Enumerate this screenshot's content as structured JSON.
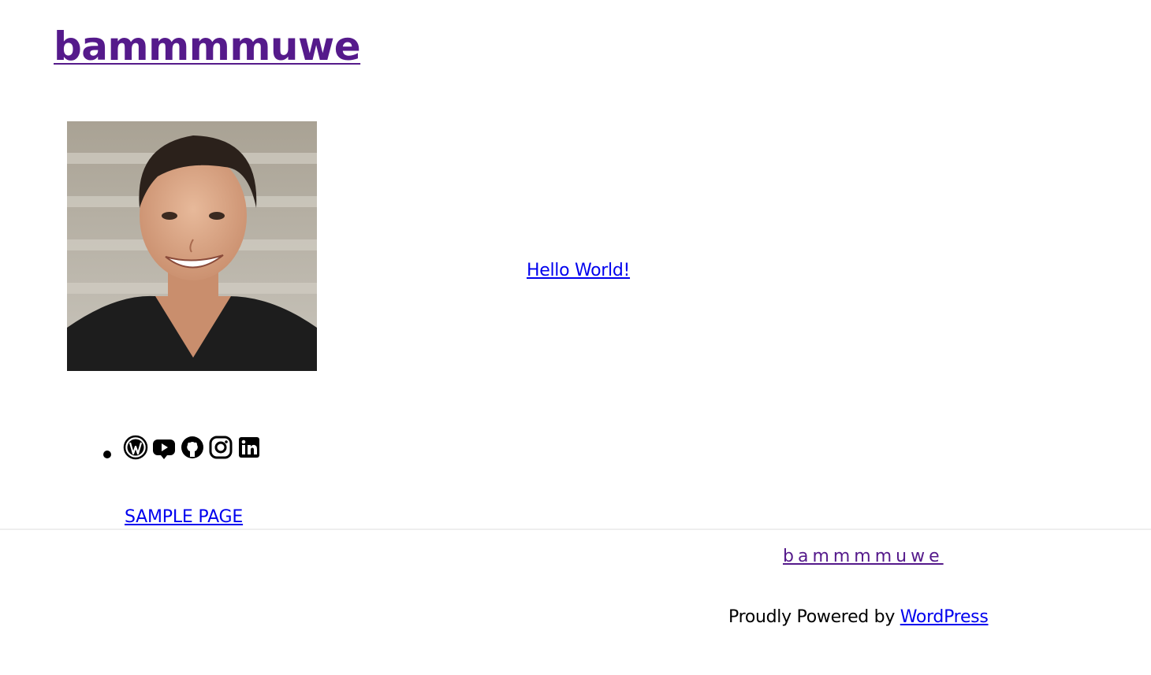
{
  "header": {
    "site_title": "bammmmuwe"
  },
  "main": {
    "avatar_alt": "profile photo",
    "post_link": "Hello World!"
  },
  "social": {
    "icons": [
      "wordpress-icon",
      "youtube-icon",
      "github-icon",
      "instagram-icon",
      "linkedin-icon"
    ]
  },
  "nav": {
    "sample_page": "SAMPLE PAGE"
  },
  "footer": {
    "site_title": "bammmmuwe",
    "powered_prefix": "Proudly Powered by ",
    "powered_link": "WordPress"
  },
  "colors": {
    "visited_link": "#551a8b",
    "link": "#0000ee",
    "divider": "#eeeeee"
  }
}
